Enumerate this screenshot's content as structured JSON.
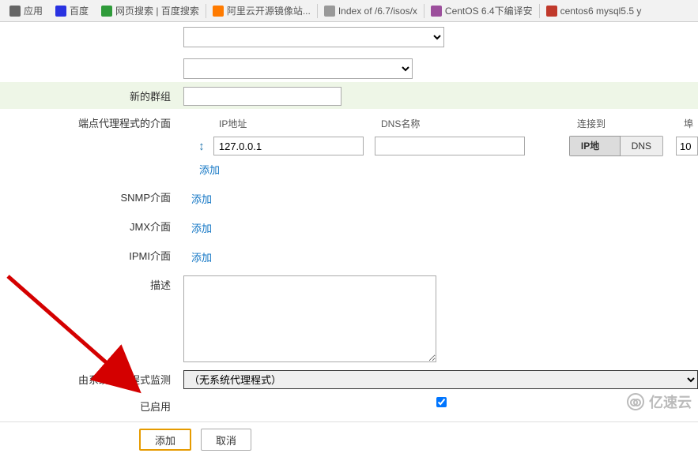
{
  "tabs": {
    "apps": "应用",
    "baidu": "百度",
    "search": "网页搜索 | 百度搜索",
    "aliyun": "阿里云开源镜像站...",
    "index": "Index of /6.7/isos/x",
    "centos_bar": "CentOS 6.4下编译安",
    "centos_mysql": "centos6 mysql5.5 y"
  },
  "labels": {
    "new_group": "新的群组",
    "agent_iface": "端点代理程式的介面",
    "snmp_iface": "SNMP介面",
    "jmx_iface": "JMX介面",
    "ipmi_iface": "IPMI介面",
    "description": "描述",
    "monitored_by": "由系统代理程式监测",
    "enabled": "已启用"
  },
  "iface_header": {
    "ip": "IP地址",
    "dns": "DNS名称",
    "conn": "连接到",
    "port": "埠"
  },
  "iface_row": {
    "ip_value": "127.0.0.1",
    "dns_value": "",
    "seg_ip": "IP地址",
    "seg_dns": "DNS",
    "port_value": "10"
  },
  "links": {
    "add": "添加"
  },
  "proxy": {
    "selected": "（无系统代理程式）"
  },
  "actions": {
    "add": "添加",
    "cancel": "取消"
  },
  "watermark": "亿速云"
}
